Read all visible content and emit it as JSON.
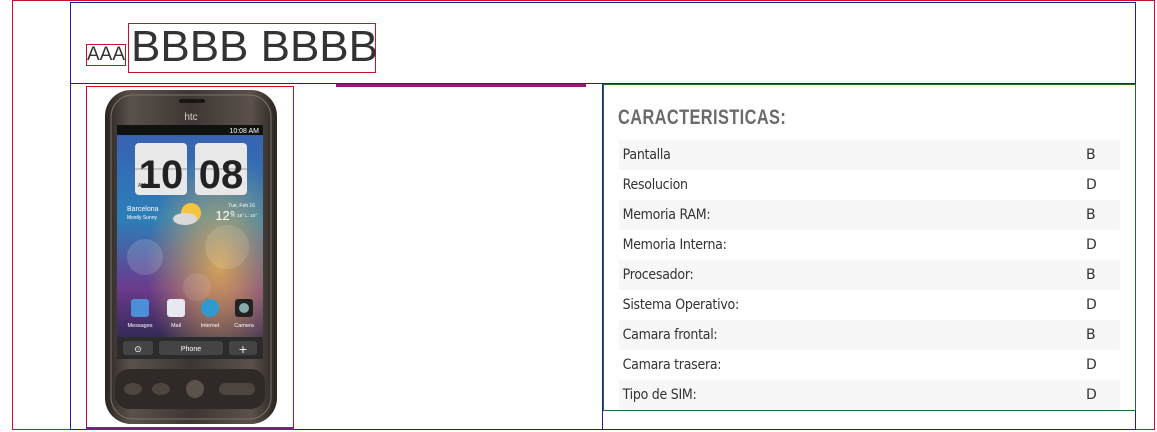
{
  "header": {
    "brand_small": "AAA",
    "title": "BBBB BBBB"
  },
  "product": {
    "image_icon": "htc-smartphone-image"
  },
  "specs": {
    "title": "CARACTERISTICAS:",
    "rows": [
      {
        "label": "Pantalla",
        "value": "B"
      },
      {
        "label": "Resolucion",
        "value": "D"
      },
      {
        "label": "Memoria RAM:",
        "value": "B"
      },
      {
        "label": "Memoria Interna:",
        "value": "D"
      },
      {
        "label": "Procesador:",
        "value": "B"
      },
      {
        "label": "Sistema Operativo:",
        "value": "D"
      },
      {
        "label": "Camara frontal:",
        "value": "B"
      },
      {
        "label": "Camara trasera:",
        "value": "D"
      },
      {
        "label": "Tipo de SIM:",
        "value": "D"
      }
    ]
  },
  "phone_screen": {
    "carrier": "htc",
    "status_time": "10:08 AM",
    "clock_hours": "10",
    "clock_minutes": "08",
    "clock_ampm": "AM",
    "city": "Barcelona",
    "condition": "Mostly Sunny",
    "date": "Tue, Feb 16",
    "temp": "12°",
    "hi_lo": "H: 16°  L: 10°",
    "apps": [
      "Messages",
      "Mail",
      "Internet",
      "Camera"
    ],
    "dock_label": "Phone"
  },
  "colors": {
    "outer_border": "#c8102e",
    "container_border": "#1e1e9c",
    "specs_border": "#1f6b3a",
    "title_grey": "#6b6b6b"
  }
}
